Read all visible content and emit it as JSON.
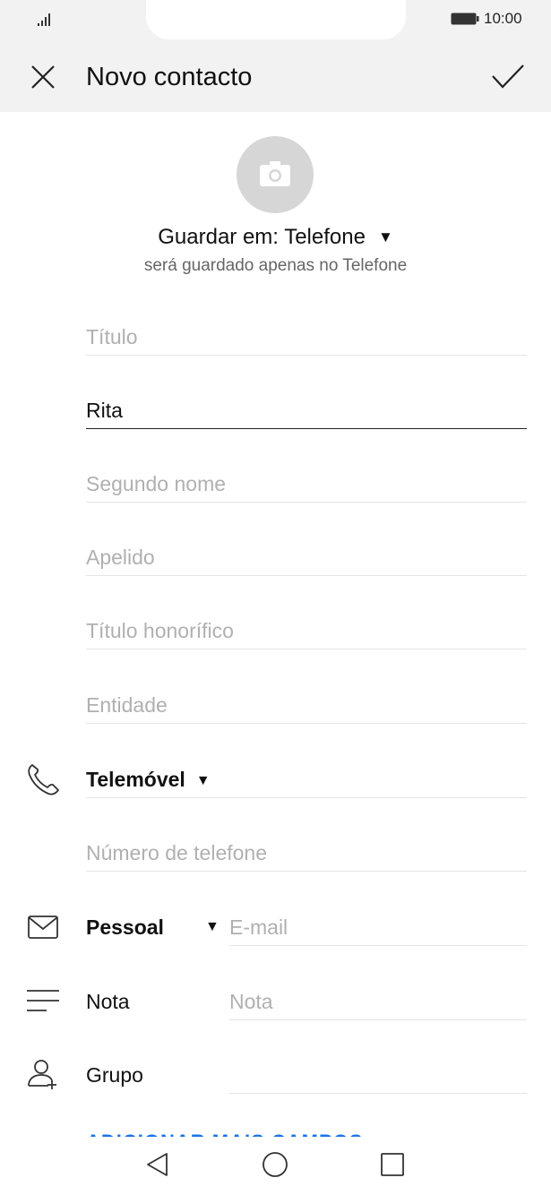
{
  "status_bar": {
    "time": "10:00"
  },
  "header": {
    "title": "Novo contacto"
  },
  "save_location": {
    "label": "Guardar em: Telefone",
    "note": "será guardado apenas no Telefone"
  },
  "fields": {
    "titulo_placeholder": "Título",
    "nome_value": "Rita",
    "segundo_nome_placeholder": "Segundo nome",
    "apelido_placeholder": "Apelido",
    "titulo_honorifico_placeholder": "Título honorífico",
    "entidade_placeholder": "Entidade"
  },
  "phone": {
    "type_label": "Telemóvel",
    "placeholder": "Número de telefone"
  },
  "email": {
    "type_label": "Pessoal",
    "placeholder": "E-mail"
  },
  "note": {
    "label": "Nota",
    "placeholder": "Nota"
  },
  "group": {
    "label": "Grupo"
  },
  "add_more_label": "ADICIONAR MAIS CAMPOS",
  "icons": {
    "close": "close-icon",
    "confirm": "check-icon",
    "camera": "camera-icon",
    "phone": "phone-icon",
    "email": "mail-icon",
    "note": "note-icon",
    "group": "group-icon"
  }
}
